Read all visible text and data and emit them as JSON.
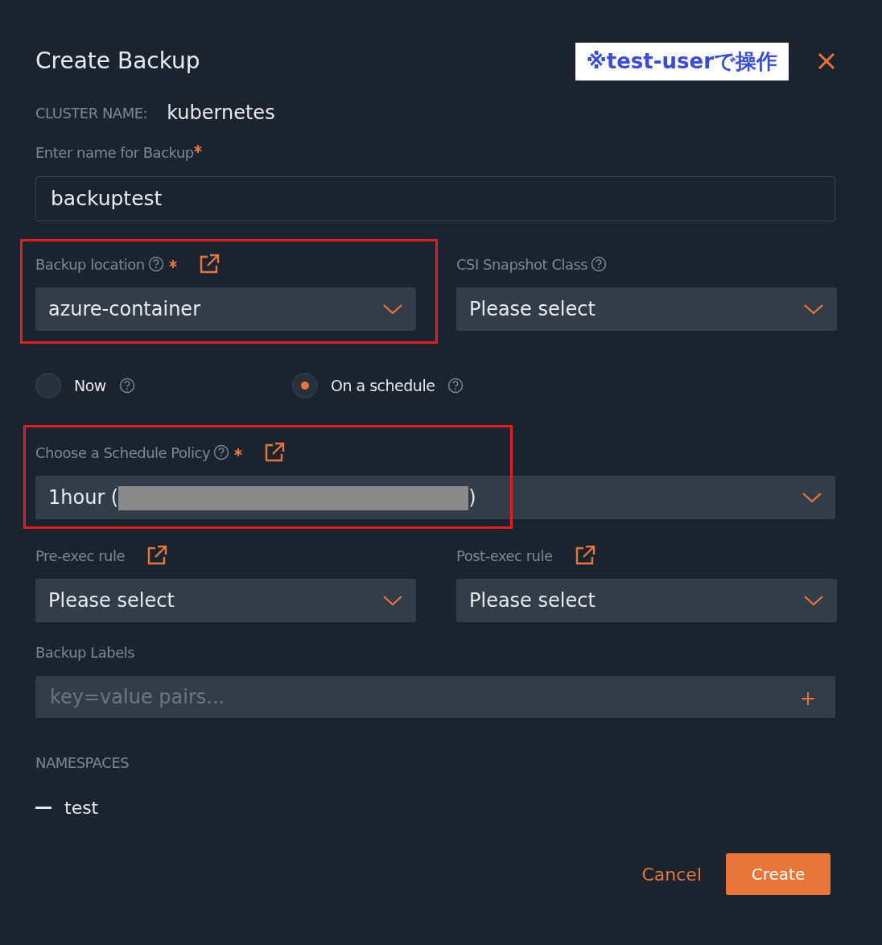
{
  "dialog": {
    "title": "Create Backup",
    "note": "※test-userで操作"
  },
  "cluster": {
    "label": "CLUSTER NAME:",
    "value": "kubernetes"
  },
  "backup_name": {
    "label": "Enter name for Backup",
    "required": true,
    "value": "backuptest"
  },
  "row1": [
    {
      "label": "Backup location",
      "help": true,
      "required": true,
      "link": true,
      "value": "azure-container",
      "highlighted": true
    },
    {
      "label": "CSI Snapshot Class",
      "help": true,
      "required": false,
      "link": false,
      "value": "Please select",
      "highlighted": false
    }
  ],
  "timing": [
    {
      "label": "Now",
      "selected": false
    },
    {
      "label": "On a schedule",
      "selected": true
    }
  ],
  "schedule_policy": {
    "label": "Choose a Schedule Policy",
    "help": true,
    "required": true,
    "link": true,
    "value": "1hour (",
    "value_end": ")",
    "redacted": true,
    "highlighted": true
  },
  "rules": [
    {
      "label": "Pre-exec rule",
      "help": false,
      "required": false,
      "link": true,
      "value": "Please select",
      "highlighted": false
    },
    {
      "label": "Post-exec rule",
      "help": false,
      "required": false,
      "link": true,
      "value": "Please select",
      "highlighted": false
    }
  ],
  "labels": {
    "label": "Backup Labels",
    "placeholder": "key=value pairs...",
    "add": "+"
  },
  "namespaces": {
    "label": "NAMESPACES",
    "items": [
      {
        "name": "test"
      }
    ]
  },
  "buttons": [
    {
      "label": "Cancel",
      "kind": "secondary"
    },
    {
      "label": "Create",
      "kind": "primary"
    }
  ]
}
